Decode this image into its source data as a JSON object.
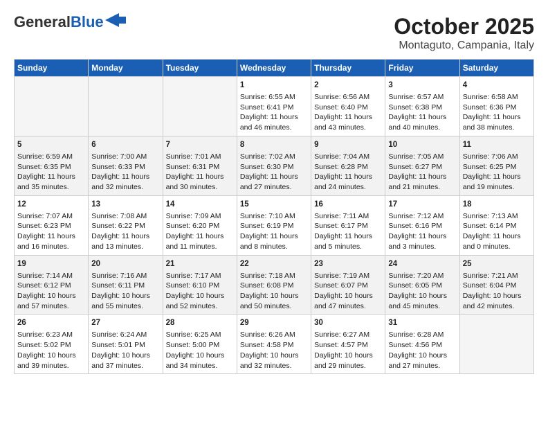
{
  "header": {
    "logo_line1": "General",
    "logo_line2": "Blue",
    "title": "October 2025",
    "subtitle": "Montaguto, Campania, Italy"
  },
  "weekdays": [
    "Sunday",
    "Monday",
    "Tuesday",
    "Wednesday",
    "Thursday",
    "Friday",
    "Saturday"
  ],
  "weeks": [
    [
      {
        "day": "",
        "info": ""
      },
      {
        "day": "",
        "info": ""
      },
      {
        "day": "",
        "info": ""
      },
      {
        "day": "1",
        "info": "Sunrise: 6:55 AM\nSunset: 6:41 PM\nDaylight: 11 hours and 46 minutes."
      },
      {
        "day": "2",
        "info": "Sunrise: 6:56 AM\nSunset: 6:40 PM\nDaylight: 11 hours and 43 minutes."
      },
      {
        "day": "3",
        "info": "Sunrise: 6:57 AM\nSunset: 6:38 PM\nDaylight: 11 hours and 40 minutes."
      },
      {
        "day": "4",
        "info": "Sunrise: 6:58 AM\nSunset: 6:36 PM\nDaylight: 11 hours and 38 minutes."
      }
    ],
    [
      {
        "day": "5",
        "info": "Sunrise: 6:59 AM\nSunset: 6:35 PM\nDaylight: 11 hours and 35 minutes."
      },
      {
        "day": "6",
        "info": "Sunrise: 7:00 AM\nSunset: 6:33 PM\nDaylight: 11 hours and 32 minutes."
      },
      {
        "day": "7",
        "info": "Sunrise: 7:01 AM\nSunset: 6:31 PM\nDaylight: 11 hours and 30 minutes."
      },
      {
        "day": "8",
        "info": "Sunrise: 7:02 AM\nSunset: 6:30 PM\nDaylight: 11 hours and 27 minutes."
      },
      {
        "day": "9",
        "info": "Sunrise: 7:04 AM\nSunset: 6:28 PM\nDaylight: 11 hours and 24 minutes."
      },
      {
        "day": "10",
        "info": "Sunrise: 7:05 AM\nSunset: 6:27 PM\nDaylight: 11 hours and 21 minutes."
      },
      {
        "day": "11",
        "info": "Sunrise: 7:06 AM\nSunset: 6:25 PM\nDaylight: 11 hours and 19 minutes."
      }
    ],
    [
      {
        "day": "12",
        "info": "Sunrise: 7:07 AM\nSunset: 6:23 PM\nDaylight: 11 hours and 16 minutes."
      },
      {
        "day": "13",
        "info": "Sunrise: 7:08 AM\nSunset: 6:22 PM\nDaylight: 11 hours and 13 minutes."
      },
      {
        "day": "14",
        "info": "Sunrise: 7:09 AM\nSunset: 6:20 PM\nDaylight: 11 hours and 11 minutes."
      },
      {
        "day": "15",
        "info": "Sunrise: 7:10 AM\nSunset: 6:19 PM\nDaylight: 11 hours and 8 minutes."
      },
      {
        "day": "16",
        "info": "Sunrise: 7:11 AM\nSunset: 6:17 PM\nDaylight: 11 hours and 5 minutes."
      },
      {
        "day": "17",
        "info": "Sunrise: 7:12 AM\nSunset: 6:16 PM\nDaylight: 11 hours and 3 minutes."
      },
      {
        "day": "18",
        "info": "Sunrise: 7:13 AM\nSunset: 6:14 PM\nDaylight: 11 hours and 0 minutes."
      }
    ],
    [
      {
        "day": "19",
        "info": "Sunrise: 7:14 AM\nSunset: 6:12 PM\nDaylight: 10 hours and 57 minutes."
      },
      {
        "day": "20",
        "info": "Sunrise: 7:16 AM\nSunset: 6:11 PM\nDaylight: 10 hours and 55 minutes."
      },
      {
        "day": "21",
        "info": "Sunrise: 7:17 AM\nSunset: 6:10 PM\nDaylight: 10 hours and 52 minutes."
      },
      {
        "day": "22",
        "info": "Sunrise: 7:18 AM\nSunset: 6:08 PM\nDaylight: 10 hours and 50 minutes."
      },
      {
        "day": "23",
        "info": "Sunrise: 7:19 AM\nSunset: 6:07 PM\nDaylight: 10 hours and 47 minutes."
      },
      {
        "day": "24",
        "info": "Sunrise: 7:20 AM\nSunset: 6:05 PM\nDaylight: 10 hours and 45 minutes."
      },
      {
        "day": "25",
        "info": "Sunrise: 7:21 AM\nSunset: 6:04 PM\nDaylight: 10 hours and 42 minutes."
      }
    ],
    [
      {
        "day": "26",
        "info": "Sunrise: 6:23 AM\nSunset: 5:02 PM\nDaylight: 10 hours and 39 minutes."
      },
      {
        "day": "27",
        "info": "Sunrise: 6:24 AM\nSunset: 5:01 PM\nDaylight: 10 hours and 37 minutes."
      },
      {
        "day": "28",
        "info": "Sunrise: 6:25 AM\nSunset: 5:00 PM\nDaylight: 10 hours and 34 minutes."
      },
      {
        "day": "29",
        "info": "Sunrise: 6:26 AM\nSunset: 4:58 PM\nDaylight: 10 hours and 32 minutes."
      },
      {
        "day": "30",
        "info": "Sunrise: 6:27 AM\nSunset: 4:57 PM\nDaylight: 10 hours and 29 minutes."
      },
      {
        "day": "31",
        "info": "Sunrise: 6:28 AM\nSunset: 4:56 PM\nDaylight: 10 hours and 27 minutes."
      },
      {
        "day": "",
        "info": ""
      }
    ]
  ]
}
